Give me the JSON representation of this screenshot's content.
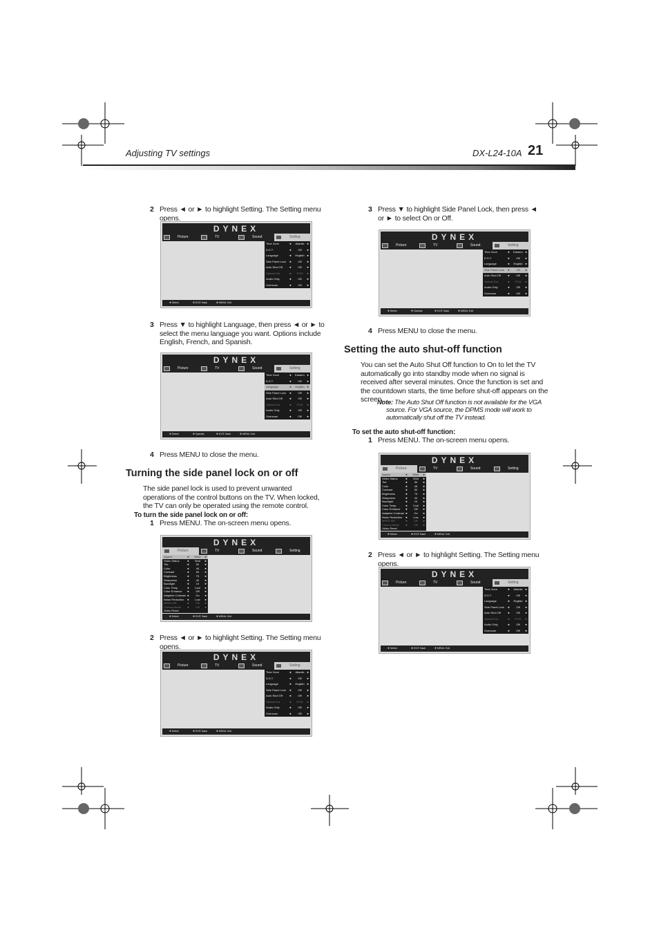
{
  "header": {
    "section": "Adjusting TV settings",
    "model": "DX-L24-10A",
    "page": "21"
  },
  "left": {
    "step2a": {
      "num": "2",
      "text": "Press ◄ or ► to highlight Setting. The Setting menu opens."
    },
    "step3": {
      "num": "3",
      "text": "Press ▼ to highlight Language, then press ◄ or ► to select the menu language you want. Options include English, French, and Spanish."
    },
    "step4": {
      "num": "4",
      "text": "Press MENU to close the menu."
    },
    "heading": "Turning the side panel lock on or off",
    "intro": "The side panel lock is used to prevent unwanted operations of the control buttons on the TV. When locked, the TV can only be operated using the remote control.",
    "subheading": "To turn the side panel lock on or off:",
    "step1": {
      "num": "1",
      "text": "Press MENU. The on-screen menu opens."
    },
    "step2b": {
      "num": "2",
      "text": "Press ◄ or ► to highlight Setting. The Setting menu opens."
    }
  },
  "right": {
    "step3": {
      "num": "3",
      "text": "Press ▼ to highlight Side Panel Lock, then press ◄ or ► to select On or Off."
    },
    "step4": {
      "num": "4",
      "text": "Press MENU to close the menu."
    },
    "heading": "Setting the auto shut-off function",
    "intro": "You can set the Auto Shut Off function to On to let the TV automatically go into standby mode when no signal is received after several minutes. Once the function is set and the countdown starts, the time before shut-off appears on the screen.",
    "note_label": "Note:",
    "note": "The Auto Shut Off function is not available for the VGA source. For VGA source, the DPMS mode will work to automatically shut off the TV instead.",
    "subheading": "To set the auto shut-off function:",
    "step1": {
      "num": "1",
      "text": "Press MENU. The on-screen menu opens."
    },
    "step2": {
      "num": "2",
      "text": "Press ◄ or ► to highlight Setting. The Setting menu opens."
    }
  },
  "menu_common": {
    "logo": "DYNEX",
    "tabs": [
      "Picture",
      "TV",
      "Sound",
      "Setting"
    ]
  },
  "menus": [
    {
      "tab": "Setting",
      "highlight": -1,
      "footer": [
        "Select",
        "EXIT: Back",
        "MENU: Exit"
      ],
      "rows": [
        [
          "Time Zone",
          "Atlantic"
        ],
        [
          "D.S.T.",
          "Off"
        ],
        [
          "Language",
          "English"
        ],
        [
          "Side Panel Lock",
          "Off"
        ],
        [
          "Auto Shut Off",
          "Off"
        ],
        [
          "Optical Out",
          "PCM",
          "dim"
        ],
        [
          "Audio Only",
          "Off"
        ],
        [
          "Overscan",
          "Off"
        ]
      ]
    },
    {
      "tab": "Setting",
      "highlight": 2,
      "footer": [
        "Select",
        "Operate",
        "EXIT: Back",
        "MENU: Exit"
      ],
      "rows": [
        [
          "Time Zone",
          "Eastern"
        ],
        [
          "D.S.T.",
          "Off"
        ],
        [
          "Language",
          "English"
        ],
        [
          "Side Panel Lock",
          "Off"
        ],
        [
          "Auto Shut Off",
          "Off"
        ],
        [
          "Optical Out",
          "PCM",
          "dim"
        ],
        [
          "Audio Only",
          "Off"
        ],
        [
          "Overscan",
          "Off"
        ]
      ]
    },
    {
      "tab": "Picture",
      "highlight": 0,
      "footer": [
        "Select",
        "EXIT: Back",
        "MENU: Exit"
      ],
      "rows": [
        [
          "Aspect",
          "Wide"
        ],
        [
          "Video Status",
          "Vivid"
        ],
        [
          "Tint",
          "50"
        ],
        [
          "Color",
          "48"
        ],
        [
          "Contrast",
          "50"
        ],
        [
          "Brightness",
          "75"
        ],
        [
          "Sharpness",
          "40"
        ],
        [
          "Backlight",
          "10"
        ],
        [
          "Color Temp",
          "Cool"
        ],
        [
          "Color Enhance",
          "Off"
        ],
        [
          "Adaptive Contrast",
          "On"
        ],
        [
          "Noise Reduction",
          "Low"
        ],
        [
          "MPEG NR",
          "Off",
          "dim"
        ],
        [
          "Cinema Mode",
          "Off",
          "dim"
        ],
        [
          "Video Reset",
          ""
        ]
      ]
    },
    {
      "tab": "Setting",
      "highlight": -1,
      "footer": [
        "Select",
        "EXIT: Back",
        "MENU: Exit"
      ],
      "rows": [
        [
          "Time Zone",
          "Atlantic"
        ],
        [
          "D.S.T.",
          "Off"
        ],
        [
          "Language",
          "English"
        ],
        [
          "Side Panel Lock",
          "Off"
        ],
        [
          "Auto Shut Off",
          "Off"
        ],
        [
          "Optical Out",
          "PCM",
          "dim"
        ],
        [
          "Audio Only",
          "Off"
        ],
        [
          "Overscan",
          "Off"
        ]
      ]
    },
    {
      "tab": "Setting",
      "highlight": 3,
      "footer": [
        "Select",
        "Operate",
        "EXIT: Back",
        "MENU: Exit"
      ],
      "rows": [
        [
          "Time Zone",
          "Eastern"
        ],
        [
          "D.S.T.",
          "Off"
        ],
        [
          "Language",
          "English"
        ],
        [
          "Side Panel Lock",
          "Off"
        ],
        [
          "Auto Shut Off",
          "Off"
        ],
        [
          "Optical Out",
          "PCM",
          "dim"
        ],
        [
          "Audio Only",
          "Off"
        ],
        [
          "Overscan",
          "Off"
        ]
      ]
    },
    {
      "tab": "Picture",
      "highlight": 0,
      "footer": [
        "Select",
        "EXIT: Back",
        "MENU: Exit"
      ],
      "rows": [
        [
          "Aspect",
          "Wide"
        ],
        [
          "Video Status",
          "Vivid"
        ],
        [
          "Tint",
          "50"
        ],
        [
          "Color",
          "48"
        ],
        [
          "Contrast",
          "50"
        ],
        [
          "Brightness",
          "75"
        ],
        [
          "Sharpness",
          "40"
        ],
        [
          "Backlight",
          "10"
        ],
        [
          "Color Temp",
          "Cool"
        ],
        [
          "Color Enhance",
          "Off"
        ],
        [
          "Adaptive Contrast",
          "On"
        ],
        [
          "Noise Reduction",
          "Low"
        ],
        [
          "MPEG NR",
          "Off",
          "dim"
        ],
        [
          "Cinema Mode",
          "Off",
          "dim"
        ],
        [
          "Video Reset",
          ""
        ]
      ]
    },
    {
      "tab": "Setting",
      "highlight": -1,
      "footer": [
        "Select",
        "EXIT: Back",
        "MENU: Exit"
      ],
      "rows": [
        [
          "Time Zone",
          "Atlantic"
        ],
        [
          "D.S.T.",
          "Off"
        ],
        [
          "Language",
          "English"
        ],
        [
          "Side Panel Lock",
          "Off"
        ],
        [
          "Auto Shut Off",
          "Off"
        ],
        [
          "Optical Out",
          "PCM",
          "dim"
        ],
        [
          "Audio Only",
          "Off"
        ],
        [
          "Overscan",
          "Off"
        ]
      ]
    }
  ]
}
